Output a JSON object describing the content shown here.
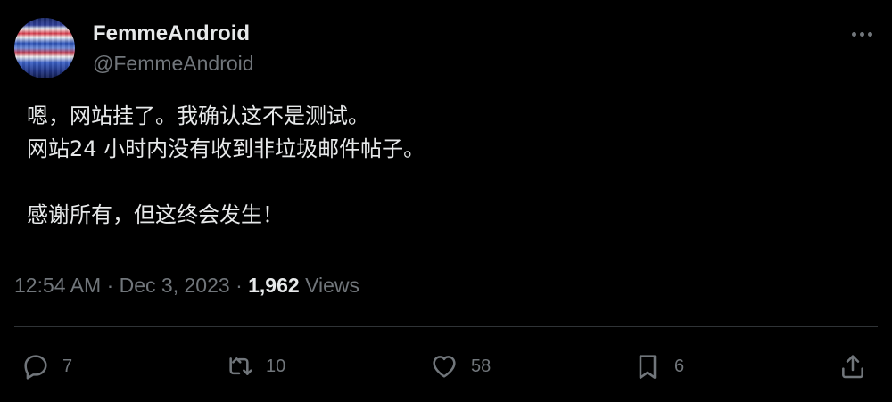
{
  "author": {
    "display_name": "FemmeAndroid",
    "handle": "@FemmeAndroid"
  },
  "tweet": {
    "lines": [
      "嗯，网站挂了。我确认这不是测试。",
      "网站24 小时内没有收到非垃圾邮件帖子。",
      "",
      "感谢所有，但这终会发生！"
    ],
    "time": "12:54 AM",
    "separator": "·",
    "date": "Dec 3, 2023",
    "views_count": "1,962",
    "views_label": "Views"
  },
  "actions": {
    "replies": "7",
    "reposts": "10",
    "likes": "58",
    "bookmarks": "6"
  },
  "icons": {
    "more": "more-horizontal-icon",
    "reply": "speech-bubble-icon",
    "repost": "repost-arrows-icon",
    "like": "heart-icon",
    "bookmark": "bookmark-icon",
    "share": "share-upload-icon"
  },
  "colors": {
    "background": "#000000",
    "text": "#e7e9ea",
    "secondary": "#71767b",
    "divider": "#2f3336"
  }
}
